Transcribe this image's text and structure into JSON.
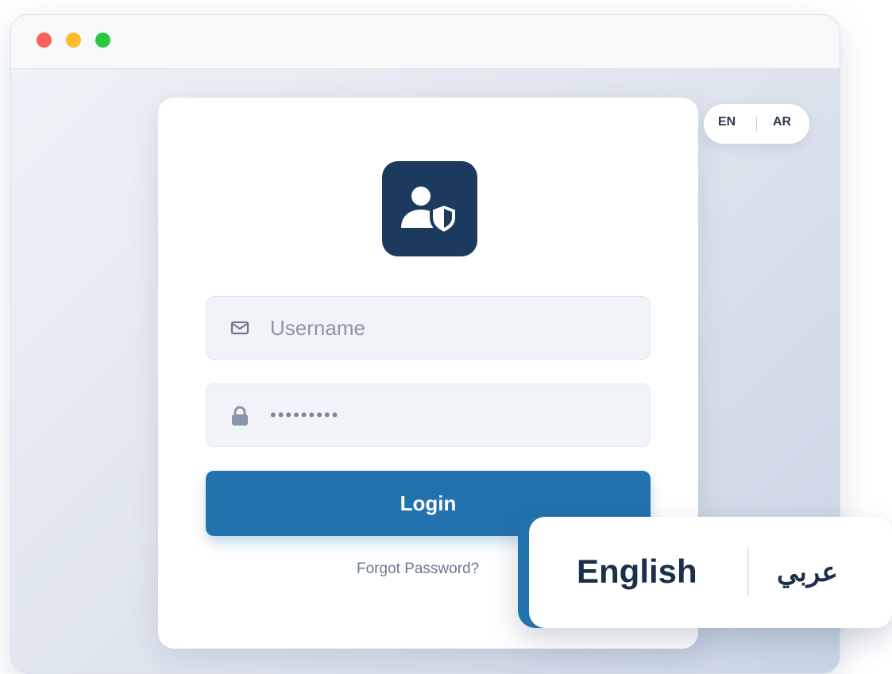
{
  "window": {
    "controls": [
      "close",
      "minimize",
      "maximize"
    ]
  },
  "language_toggle": {
    "en": "EN",
    "ar": "AR"
  },
  "login_form": {
    "logo_icon": "user-shield-icon",
    "username": {
      "icon": "mail-icon",
      "placeholder": "Username",
      "value": ""
    },
    "password": {
      "icon": "lock-icon",
      "value": "•••••••••"
    },
    "login_label": "Login",
    "forgot_label": "Forgot Password?"
  },
  "language_card": {
    "english_label": "English",
    "arabic_label": "عربي"
  },
  "colors": {
    "primary": "#2272ad",
    "logo_tile": "#1b3a5e",
    "heading_text": "#1b2f4b",
    "close": "#ff5f57",
    "minimize": "#febc2e",
    "maximize": "#28c840"
  }
}
